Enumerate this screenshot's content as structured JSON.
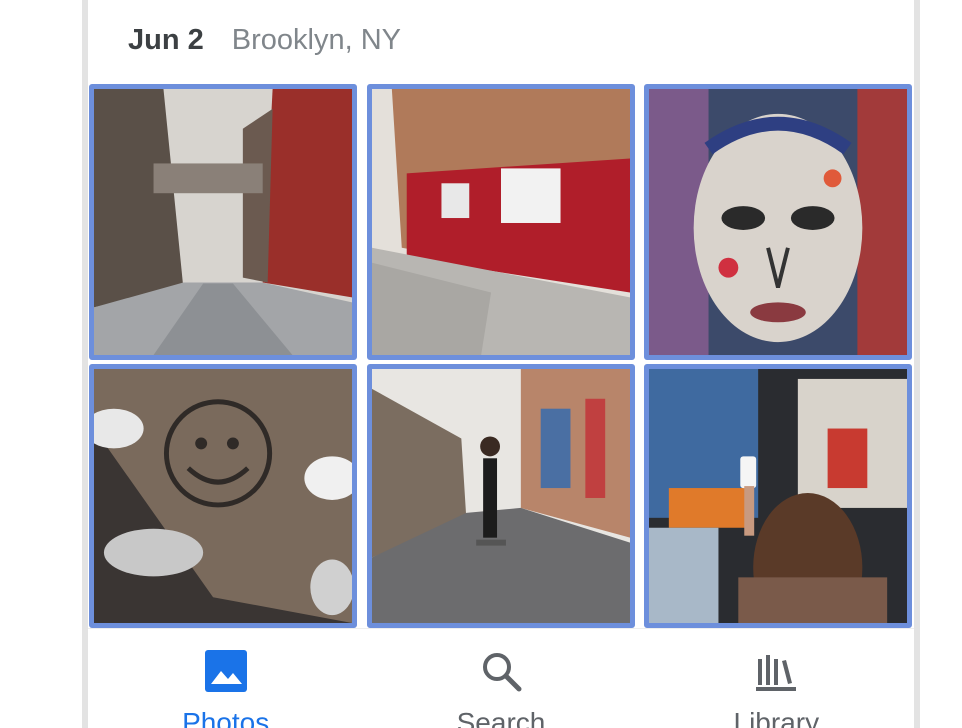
{
  "header": {
    "date": "Jun 2",
    "location": "Brooklyn, NY"
  },
  "photos": [
    {
      "name": "photo-street-skybridge",
      "description_icon": "photo-icon"
    },
    {
      "name": "photo-red-storefront",
      "description_icon": "photo-icon"
    },
    {
      "name": "photo-mural-face",
      "description_icon": "photo-icon"
    },
    {
      "name": "photo-smiley-pavement",
      "description_icon": "photo-icon"
    },
    {
      "name": "photo-alley-skater",
      "description_icon": "photo-icon"
    },
    {
      "name": "photo-graffiti-phone",
      "description_icon": "photo-icon"
    }
  ],
  "nav": {
    "photos_label": "Photos",
    "search_label": "Search",
    "library_label": "Library",
    "active": "photos"
  },
  "colors": {
    "selection_border": "#6d8fdc",
    "active_nav": "#1a73e8",
    "inactive_nav": "#5f6368"
  }
}
